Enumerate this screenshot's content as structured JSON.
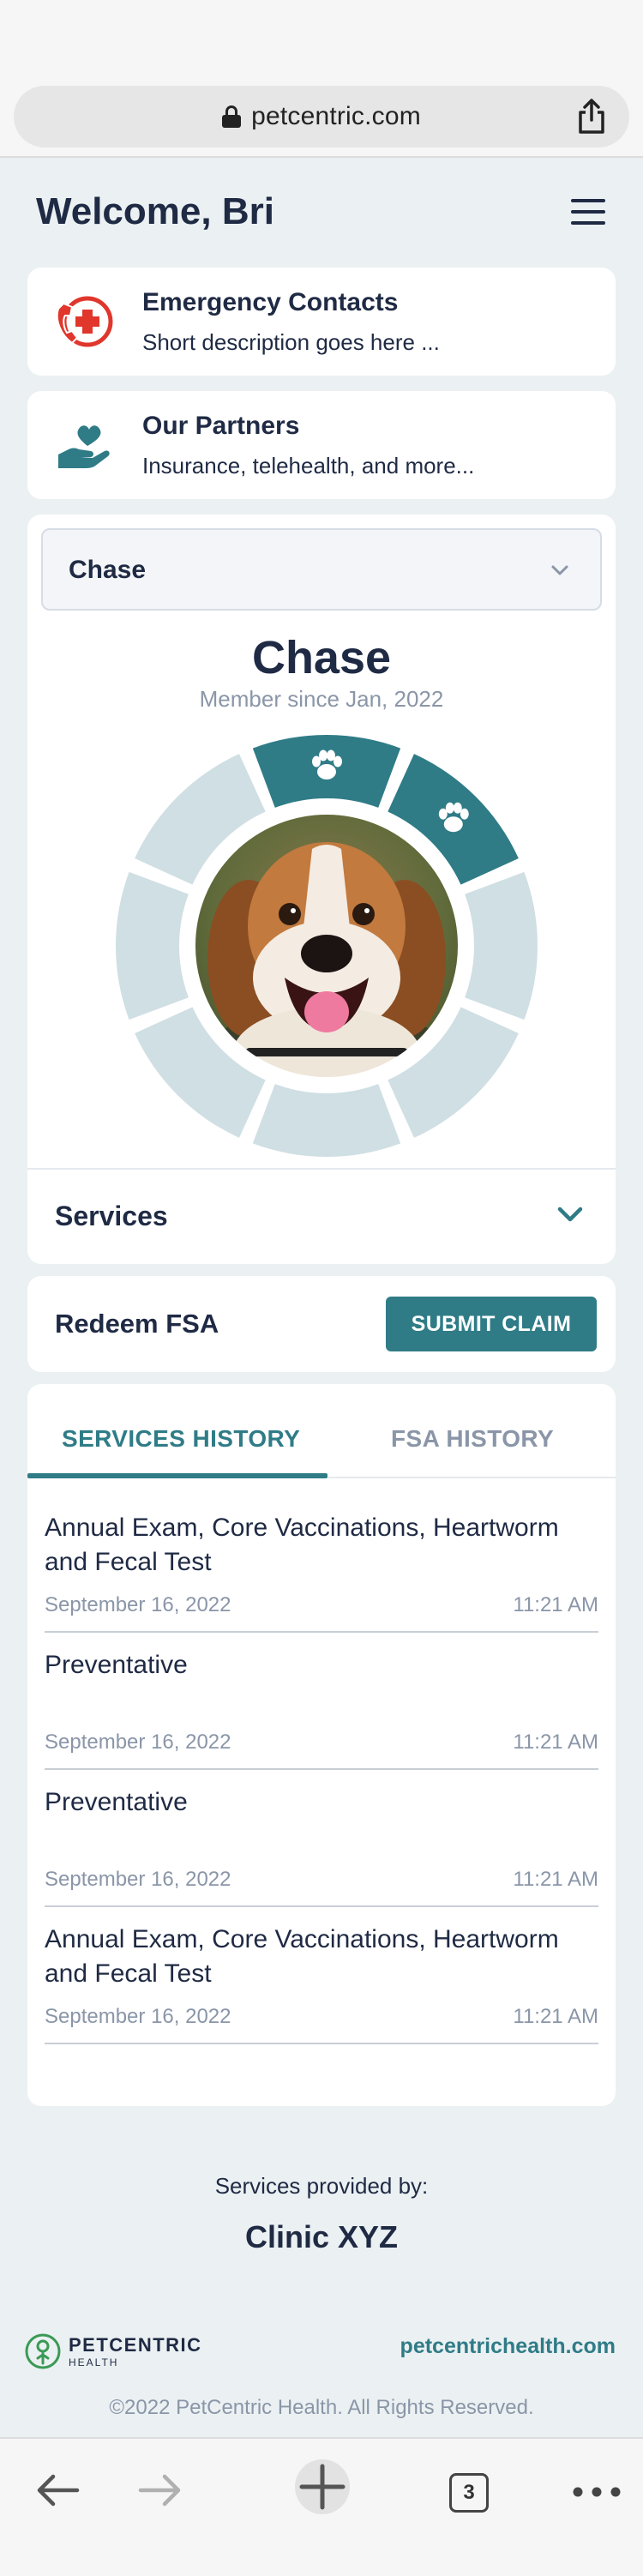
{
  "browser": {
    "url": "petcentric.com",
    "tab_count": "3"
  },
  "header": {
    "welcome": "Welcome, Bri"
  },
  "quick_links": [
    {
      "title": "Emergency Contacts",
      "description": "Short description goes here ...",
      "icon": "medical-phone-icon"
    },
    {
      "title": "Our Partners",
      "description": "Insurance, telehealth, and more...",
      "icon": "heart-hand-icon"
    }
  ],
  "pet": {
    "selected": "Chase",
    "name": "Chase",
    "member_since": "Member since Jan, 2022",
    "progress": {
      "segments_total": 8,
      "segments_completed": 2
    }
  },
  "services": {
    "label": "Services"
  },
  "fsa": {
    "label": "Redeem FSA",
    "button": "SUBMIT CLAIM"
  },
  "history": {
    "tabs": [
      "SERVICES HISTORY",
      "FSA HISTORY"
    ],
    "active_tab": "SERVICES HISTORY",
    "items": [
      {
        "title": "Annual Exam, Core Vaccinations, Heartworm and Fecal Test",
        "date": "September 16, 2022",
        "time": "11:21 AM"
      },
      {
        "title": "Preventative",
        "date": "September 16, 2022",
        "time": "11:21 AM"
      },
      {
        "title": "Preventative",
        "date": "September 16, 2022",
        "time": "11:21 AM"
      },
      {
        "title": "Annual Exam, Core Vaccinations, Heartworm and Fecal Test",
        "date": "September 16, 2022",
        "time": "11:21 AM"
      }
    ]
  },
  "footer": {
    "provided_by": "Services provided by:",
    "clinic": "Clinic XYZ",
    "brand_name": "PETCENTRIC",
    "brand_sub": "HEALTH",
    "site": "petcentrichealth.com",
    "copyright": "©2022 PetCentric Health. All Rights Reserved."
  },
  "colors": {
    "accent": "#2f7c87",
    "ring_inactive": "#cfdfe3",
    "text_dark": "#1f2a44",
    "text_muted": "#8a96a8",
    "emergency_red": "#e0362c"
  }
}
